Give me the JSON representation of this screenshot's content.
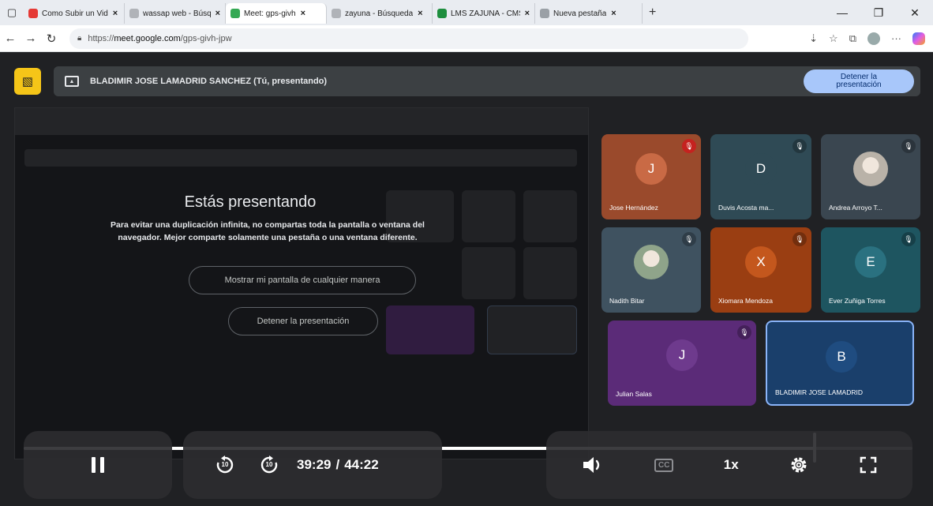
{
  "browser": {
    "tabs": [
      {
        "title": "Como Subir un Vid",
        "favicon_color": "#e53935",
        "active": false
      },
      {
        "title": "wassap web - Búsq",
        "favicon_color": "#b0b3b8",
        "active": false
      },
      {
        "title": "Meet: gps-givh",
        "favicon_color": "#34a853",
        "active": true
      },
      {
        "title": "zayuna - Búsqueda",
        "favicon_color": "#b0b3b8",
        "active": false
      },
      {
        "title": "LMS ZAJUNA - CMS",
        "favicon_color": "#1e8e3e",
        "active": false
      },
      {
        "title": "Nueva pestaña",
        "favicon_color": "#9aa0a6",
        "active": false
      }
    ],
    "new_tab_label": "+",
    "url_prefix": "https://",
    "url_host": "meet.google.com",
    "url_path": "/gps-givh-jpw"
  },
  "meet": {
    "presenter_banner": "BLADIMIR JOSE LAMADRID SANCHEZ (Tú, presentando)",
    "stop_presenting_label": "Detener la presentación",
    "presenting_title": "Estás presentando",
    "presenting_body": "Para evitar una duplicación infinita, no compartas toda la pantalla o ventana del navegador. Mejor comparte solamente una pestaña o una ventana diferente.",
    "show_anyway_label": "Mostrar mi pantalla de cualquier manera",
    "stop_inner_label": "Detener la presentación",
    "participants": [
      {
        "initial": "J",
        "name": "Jose Hernández",
        "tile_color": "#9a4a2c",
        "avatar_color": "#c96a45"
      },
      {
        "initial": "D",
        "name": "Duvis Acosta ma...",
        "tile_color": "#2f4a55",
        "avatar_color": "#2f4a55"
      },
      {
        "initial": "",
        "name": "Andrea Arroyo T...",
        "tile_color": "#3a4650",
        "avatar_color": "#b9b2a8"
      },
      {
        "initial": "",
        "name": "Nadith Bitar",
        "tile_color": "#3f5260",
        "avatar_color": "#8fa48a"
      },
      {
        "initial": "X",
        "name": "Xiomara Mendoza",
        "tile_color": "#9a3e12",
        "avatar_color": "#c4571d"
      },
      {
        "initial": "E",
        "name": "Ever Zuñiga Torres",
        "tile_color": "#1e5560",
        "avatar_color": "#2a7180"
      },
      {
        "initial": "J",
        "name": "Julian Salas",
        "tile_color": "#5b2b78",
        "avatar_color": "#6e3a8d"
      },
      {
        "initial": "B",
        "name": "BLADIMIR JOSE LAMADRID",
        "tile_color": "#1a3f6b",
        "avatar_color": "#1f4c80"
      }
    ]
  },
  "player": {
    "current_time": "39:29",
    "total_time": "44:22",
    "time_separator": "/",
    "progress_fraction": 0.89,
    "skip_back_seconds": "10",
    "skip_forward_seconds": "10",
    "cc_label": "CC",
    "speed_label": "1x"
  }
}
